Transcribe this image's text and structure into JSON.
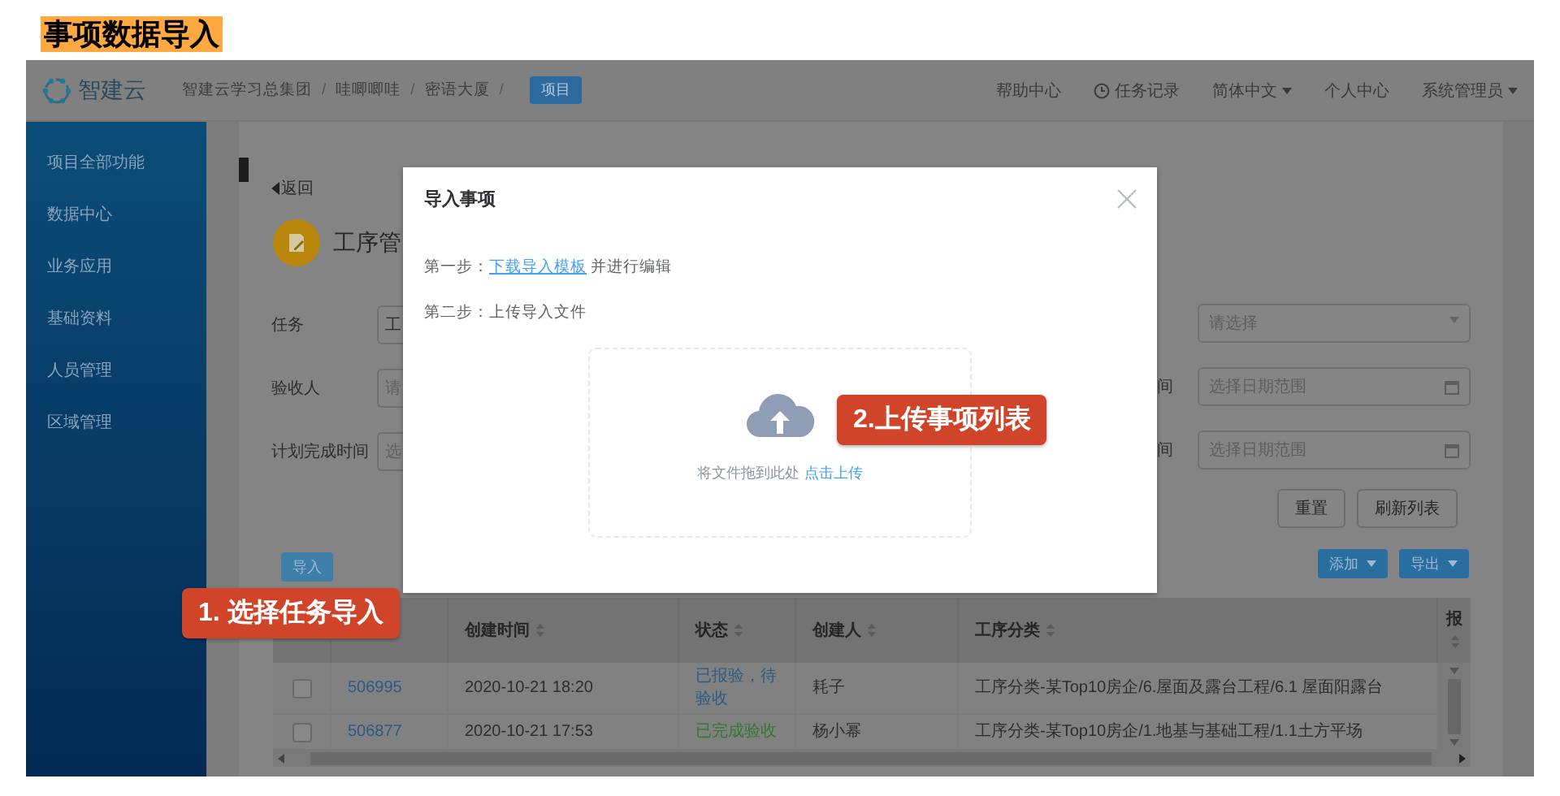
{
  "page_title": "事项数据导入",
  "header": {
    "logo_text": "智建云",
    "breadcrumb": [
      {
        "label": "智建云学习总集团",
        "separator": "/"
      },
      {
        "label": "哇唧唧哇",
        "separator": "/"
      },
      {
        "label": "密语大厦",
        "separator": "/"
      }
    ],
    "badge": "项目",
    "nav": [
      {
        "label": "帮助中心",
        "kind": "plain"
      },
      {
        "label": "任务记录",
        "kind": "clock"
      },
      {
        "label": "简体中文",
        "kind": "dropdown"
      },
      {
        "label": "个人中心",
        "kind": "plain"
      },
      {
        "label": "系统管理员",
        "kind": "dropdown"
      }
    ]
  },
  "sidebar": {
    "items": [
      "项目全部功能",
      "数据中心",
      "业务应用",
      "基础资料",
      "人员管理",
      "区域管理"
    ]
  },
  "page": {
    "back": "返回",
    "title": "工序管"
  },
  "filters_left": [
    {
      "label": "任务",
      "value": "工"
    },
    {
      "label": "验收人",
      "placeholder": "请"
    },
    {
      "label": "计划完成时间",
      "placeholder": "选"
    }
  ],
  "filters_right": [
    {
      "kind": "select",
      "placeholder": "请选择"
    },
    {
      "kind": "date",
      "label": "间",
      "placeholder": "选择日期范围"
    },
    {
      "kind": "date",
      "label": "间",
      "placeholder": "选择日期范围"
    }
  ],
  "buttons": {
    "reset": "重置",
    "refresh": "刷新列表",
    "import": "导入",
    "add": "添加",
    "export": "导出"
  },
  "modal": {
    "title": "导入事项",
    "steps": [
      {
        "label": "第一步：",
        "link": "下载导入模板",
        "text": "并进行编辑"
      },
      {
        "label": "第二步：",
        "text": "上传导入文件"
      }
    ],
    "upload": {
      "hint": "将文件拖到此处",
      "link": "点击上传"
    }
  },
  "table": {
    "columns": [
      "创建时间",
      "状态",
      "创建人",
      "工序分类",
      "报"
    ],
    "rows": [
      {
        "checked": false,
        "id": "506995",
        "created": "2020-10-21 18:20",
        "status": {
          "text": "已报验，待验收",
          "kind": "pending"
        },
        "creator": "耗子",
        "category": "工序分类-某Top10房企/6.屋面及露台工程/6.1 屋面阳露台"
      },
      {
        "checked": false,
        "id": "506877",
        "created": "2020-10-21 17:53",
        "status": {
          "text": "已完成验收",
          "kind": "done"
        },
        "creator": "杨小幂",
        "category": "工序分类-某Top10房企/1.地基与基础工程/1.1土方平场"
      }
    ]
  },
  "callouts": [
    "1. 选择任务导入",
    "2.上传事项列表"
  ]
}
